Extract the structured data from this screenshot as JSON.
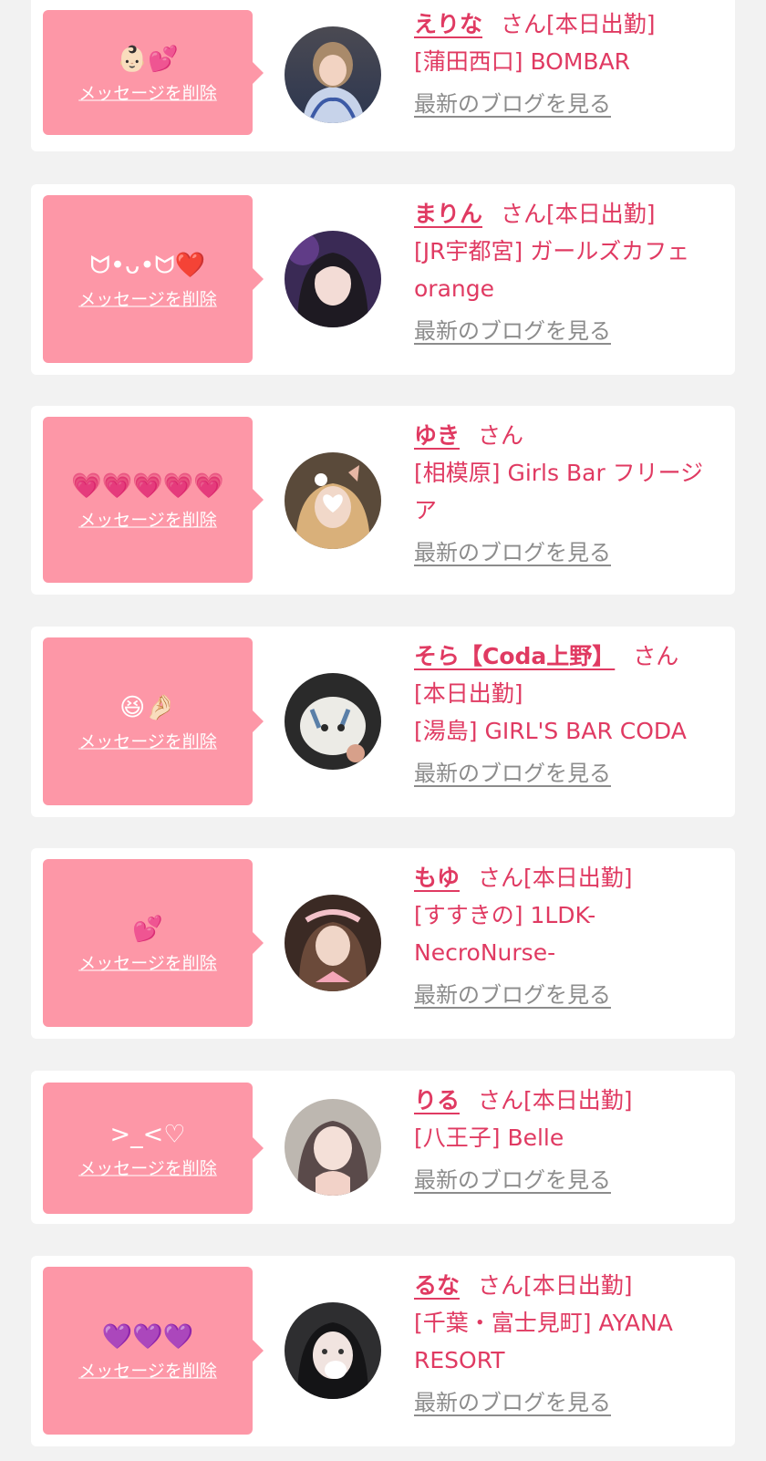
{
  "favorites": [
    {
      "message": "👶🏻💕",
      "delete_label": "メッセージを削除",
      "name": "えりな",
      "honorific": "さん",
      "status": "[本日出勤]",
      "shop": "[蒲田西口] BOMBAR",
      "blog_label": "最新のブログを見る",
      "avatar_icon": "cast-photo-avatar"
    },
    {
      "message": "ᗢ•ᴗ•ᗢ❤️",
      "delete_label": "メッセージを削除",
      "name": "まりん",
      "honorific": "さん",
      "status": "[本日出勤]",
      "shop": "[JR宇都宮] ガールズカフェorange",
      "blog_label": "最新のブログを見る",
      "avatar_icon": "cast-photo-avatar"
    },
    {
      "message": "💗💗💗💗💗",
      "delete_label": "メッセージを削除",
      "name": "ゆき",
      "honorific": "さん",
      "status": "",
      "shop": "[相模原] Girls Bar フリージア",
      "blog_label": "最新のブログを見る",
      "avatar_icon": "cast-photo-avatar"
    },
    {
      "message": "😆🤌🏻",
      "delete_label": "メッセージを削除",
      "name": "そら【Coda上野】",
      "honorific": "さん",
      "status": "[本日出勤]",
      "shop": "[湯島] GIRL'S BAR CODA",
      "blog_label": "最新のブログを見る",
      "avatar_icon": "cast-photo-avatar"
    },
    {
      "message": "💕",
      "delete_label": "メッセージを削除",
      "name": "もゆ",
      "honorific": "さん",
      "status": "[本日出勤]",
      "shop": "[すすきの] 1LDK-NecroNurse-",
      "blog_label": "最新のブログを見る",
      "avatar_icon": "cast-photo-avatar"
    },
    {
      "message": ">_<♡",
      "delete_label": "メッセージを削除",
      "name": "りる",
      "honorific": "さん",
      "status": "[本日出勤]",
      "shop": "[八王子] Belle",
      "blog_label": "最新のブログを見る",
      "avatar_icon": "cast-photo-avatar"
    },
    {
      "message": "💜💜💜",
      "delete_label": "メッセージを削除",
      "name": "るな",
      "honorific": "さん",
      "status": "[本日出勤]",
      "shop": "[千葉・富士見町] AYANA RESORT",
      "blog_label": "最新のブログを見る",
      "avatar_icon": "cast-photo-avatar"
    }
  ],
  "colors": {
    "page_background": "#f2f2f2",
    "card_background": "#ffffff",
    "bubble_pink": "#fd97a7",
    "name_pink": "#e03a62",
    "link_gray": "#8c8c8c"
  }
}
